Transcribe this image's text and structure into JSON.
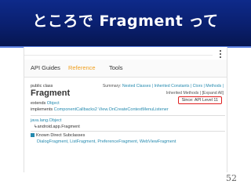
{
  "slide": {
    "title": "ところで Fragment って",
    "number": "52"
  },
  "nav": {
    "tabs": [
      {
        "label": "API Guides",
        "active": false
      },
      {
        "label": "Reference",
        "active": true
      },
      {
        "label": "Tools",
        "active": false
      }
    ]
  },
  "doc": {
    "summary_prefix": "Summary:",
    "summary_links": "Nested Classes | Inherited Constants | Ctors | Methods |",
    "inherited_methods": "Inherited Methods | [Expand All]",
    "since": "Since: API Level 11",
    "modifiers": "public class",
    "class_name": "Fragment",
    "extends_label": "extends",
    "extends_value": "Object",
    "implements_label": "implements",
    "implements_value": "ComponentCallbacks2 View.OnCreateContextMenuListener",
    "hierarchy_root": "java.lang.Object",
    "hierarchy_child": "↳android.app.Fragment",
    "subclasses_label": "Known Direct Subclasses",
    "subclasses": "DialogFragment, ListFragment, PreferenceFragment, WebViewFragment"
  },
  "colors": {
    "header_bg": "#0a1f6e",
    "accent_link": "#258aaf",
    "active_tab": "#f0a020",
    "highlight_box": "#e02020"
  }
}
